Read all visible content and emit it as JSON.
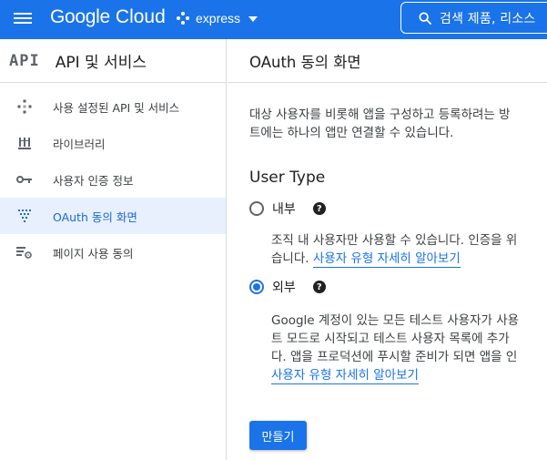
{
  "brand": {
    "google": "Google",
    "cloud": "Cloud"
  },
  "project": {
    "name": "express"
  },
  "search": {
    "placeholder": "검색   제품, 리소스"
  },
  "sidebar": {
    "api_logo": "API",
    "title": "API 및 서비스",
    "items": [
      {
        "label": "사용 설정된 API 및 서비스",
        "icon": "diamond-dots-icon"
      },
      {
        "label": "라이브러리",
        "icon": "library-icon"
      },
      {
        "label": "사용자 인증 정보",
        "icon": "key-icon"
      },
      {
        "label": "OAuth 동의 화면",
        "icon": "oauth-dots-icon",
        "active": true
      },
      {
        "label": "페이지 사용 동의",
        "icon": "settings-list-icon"
      }
    ]
  },
  "main": {
    "title": "OAuth 동의 화면",
    "intro_line1": "대상 사용자를 비롯해 앱을 구성하고 등록하려는 방",
    "intro_line2": "트에는 하나의 앱만 연결할 수 있습니다.",
    "user_type_label": "User Type",
    "options": [
      {
        "label": "내부",
        "checked": false,
        "desc_line1": "조직 내 사용자만 사용할 수 있습니다. 인증을 위",
        "desc_line2_prefix": "습니다.",
        "link": "사용자 유형 자세히 알아보기"
      },
      {
        "label": "외부",
        "checked": true,
        "desc_line1": "Google 계정이 있는 모든 테스트 사용자가 사용",
        "desc_line2": "트 모드로 시작되고 테스트 사용자 목록에 추가",
        "desc_line3": "다. 앱을 프로덕션에 푸시할 준비가 되면 앱을 인",
        "link": "사용자 유형 자세히 알아보기"
      }
    ],
    "create_button": "만들기"
  },
  "colors": {
    "primary": "#1a73e8",
    "active_bg": "#e8f0fe",
    "border": "#dadce0"
  }
}
